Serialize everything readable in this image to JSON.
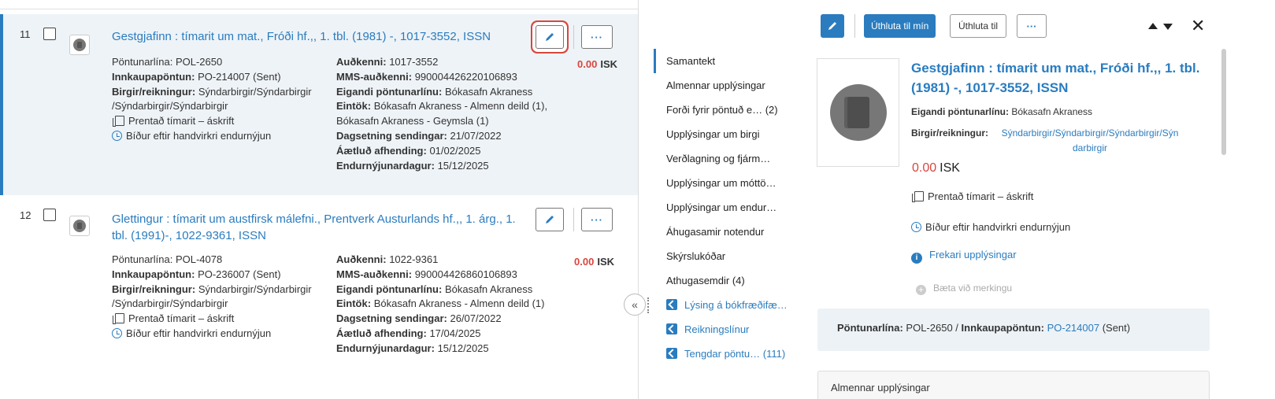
{
  "items": [
    {
      "number": "11",
      "title": "Gestgjafinn : tímarit um mat., Fróði hf.,, 1. tbl. (1981) -, 1017-3552, ISSN",
      "col1": {
        "pol_label": "Pöntunarlína:",
        "pol_value": "POL-2650",
        "po_label": "Innkaupapöntun:",
        "po_value": "PO-214007 (Sent)",
        "vendor_label": "Birgir/reikningur:",
        "vendor_value": "Sýndarbirgir/Sýndarbirgir /Sýndarbirgir/Sýndarbirgir",
        "type": "Prentað tímarit – áskrift",
        "status": "Bíður eftir handvirkri endurnýjun"
      },
      "col2": {
        "id_label": "Auðkenni:",
        "id_value": "1017-3552",
        "mms_label": "MMS-auðkenni:",
        "mms_value": "990004426220106893",
        "owner_label": "Eigandi pöntunarlínu:",
        "owner_value": "Bókasafn Akraness",
        "copies_label": "Eintök:",
        "copies_value": "Bókasafn Akraness - Almenn deild (1), Bókasafn Akraness - Geymsla (1)",
        "sent_label": "Dagsetning sendingar:",
        "sent_value": "21/07/2022",
        "expected_label": "Áætluð afhending:",
        "expected_value": "01/02/2025",
        "renewal_label": "Endurnýjunardagur:",
        "renewal_value": "15/12/2025"
      },
      "price": "0.00",
      "currency": "ISK"
    },
    {
      "number": "12",
      "title": "Glettingur : tímarit um austfirsk málefni., Prentverk Austurlands hf.,, 1. árg., 1. tbl. (1991)-, 1022-9361, ISSN",
      "col1": {
        "pol_label": "Pöntunarlína:",
        "pol_value": "POL-4078",
        "po_label": "Innkaupapöntun:",
        "po_value": "PO-236007 (Sent)",
        "vendor_label": "Birgir/reikningur:",
        "vendor_value": "Sýndarbirgir/Sýndarbirgir /Sýndarbirgir/Sýndarbirgir",
        "type": "Prentað tímarit – áskrift",
        "status": "Bíður eftir handvirkri endurnýjun"
      },
      "col2": {
        "id_label": "Auðkenni:",
        "id_value": "1022-9361",
        "mms_label": "MMS-auðkenni:",
        "mms_value": "990004426860106893",
        "owner_label": "Eigandi pöntunarlínu:",
        "owner_value": "Bókasafn Akraness",
        "copies_label": "Eintök:",
        "copies_value": "Bókasafn Akraness - Almenn deild (1)",
        "sent_label": "Dagsetning sendingar:",
        "sent_value": "26/07/2022",
        "expected_label": "Áætluð afhending:",
        "expected_value": "17/04/2025",
        "renewal_label": "Endurnýjunardagur:",
        "renewal_value": "15/12/2025"
      },
      "price": "0.00",
      "currency": "ISK"
    }
  ],
  "panel": {
    "assign_to_me": "Úthluta til mín",
    "assign_to": "Úthluta til",
    "more": "···",
    "close": "✕",
    "collapse": "«",
    "tabs": [
      "Samantekt",
      "Almennar upplýsingar",
      "Forði fyrir pöntuð e… (2)",
      "Upplýsingar um birgi",
      "Verðlagning og fjárm…",
      "Upplýsingar um móttö…",
      "Upplýsingar um endur…",
      "Áhugasamir notendur",
      "Skýrslukóðar",
      "Athugasemdir (4)",
      "Lýsing á bókfræðifæ…",
      "Reikningslínur",
      "Tengdar pöntu… (111)"
    ],
    "title": "Gestgjafinn : tímarit um mat., Fróði hf.,, 1. tbl. (1981) -, 1017-3552, ISSN",
    "owner_label": "Eigandi pöntunarlínu:",
    "owner_value": "Bókasafn Akraness",
    "vendor_label": "Birgir/reikningur:",
    "vendor_value": "Sýndarbirgir/Sýndarbirgir/Sýndarbirgir/Sýn darbirgir",
    "price": "0.00",
    "currency": "ISK",
    "type": "Prentað tímarit – áskrift",
    "status": "Bíður eftir handvirkri endurnýjun",
    "more_info": "Frekari upplýsingar",
    "add_tag": "Bæta við merkingu",
    "summary_pol_label": "Pöntunarlína:",
    "summary_pol_value": "POL-2650",
    "summary_sep": " / ",
    "summary_po_label": "Innkaupapöntun:",
    "summary_po_value": "PO-214007",
    "summary_po_status": " (Sent)",
    "accordion_title": "Almennar upplýsingar"
  },
  "colors": {
    "accent": "#2a7cbf",
    "price": "#d9463e",
    "highlight": "#d9463e"
  }
}
